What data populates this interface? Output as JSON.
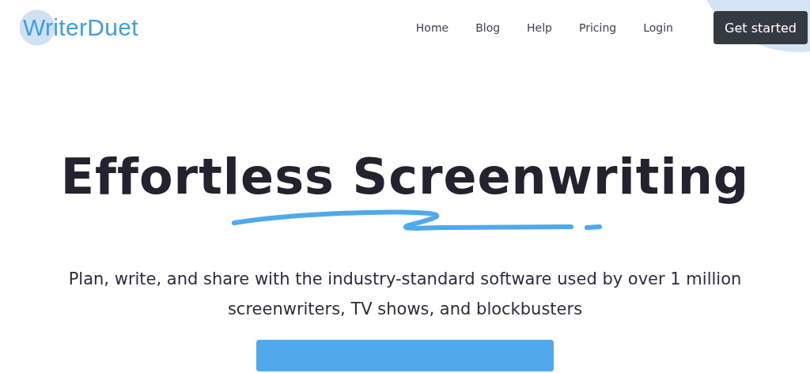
{
  "header": {
    "logo": "WriterDuet",
    "nav": [
      {
        "label": "Home"
      },
      {
        "label": "Blog"
      },
      {
        "label": "Help"
      },
      {
        "label": "Pricing"
      },
      {
        "label": "Login"
      }
    ],
    "cta": "Get started"
  },
  "hero": {
    "title": "Effortless Screenwriting",
    "subtitle": "Plan, write, and share with the industry-standard software used by over 1 million screenwriters, TV shows, and blockbusters"
  }
}
